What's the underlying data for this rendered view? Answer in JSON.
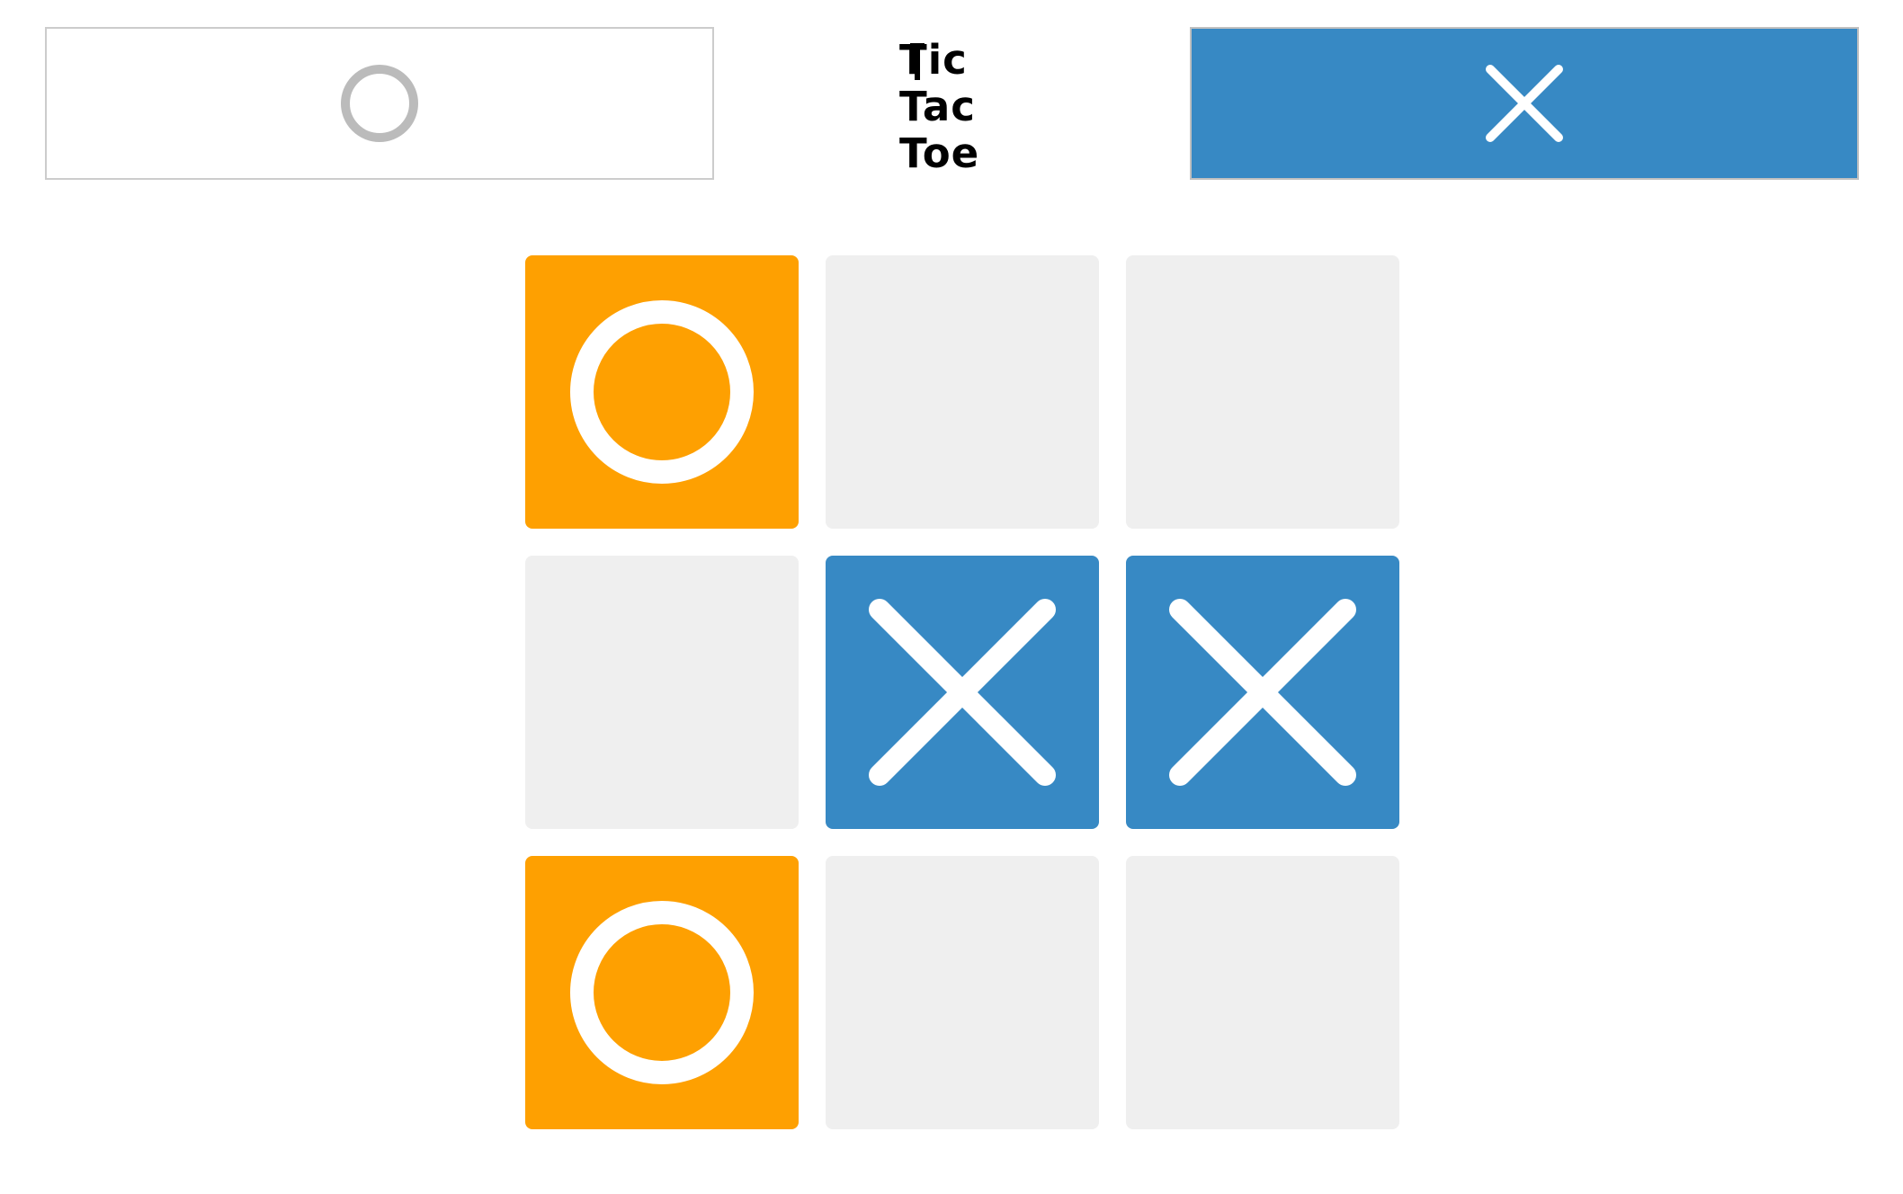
{
  "game": {
    "title_lines": [
      "Tic",
      "Tac",
      "Toe"
    ],
    "current_turn": "X",
    "players": [
      {
        "mark": "O",
        "active": false,
        "icon": "o-icon"
      },
      {
        "mark": "X",
        "active": true,
        "icon": "x-icon"
      }
    ],
    "board": [
      [
        "O",
        "",
        ""
      ],
      [
        "",
        "X",
        "X"
      ],
      [
        "O",
        "",
        ""
      ]
    ],
    "colors": {
      "o_tile": "#fea001",
      "x_tile": "#3789c4",
      "empty_tile": "#efefef",
      "active_panel": "#3789c4",
      "mark": "#ffffff",
      "inactive_mark": "#bbbbbb"
    }
  }
}
